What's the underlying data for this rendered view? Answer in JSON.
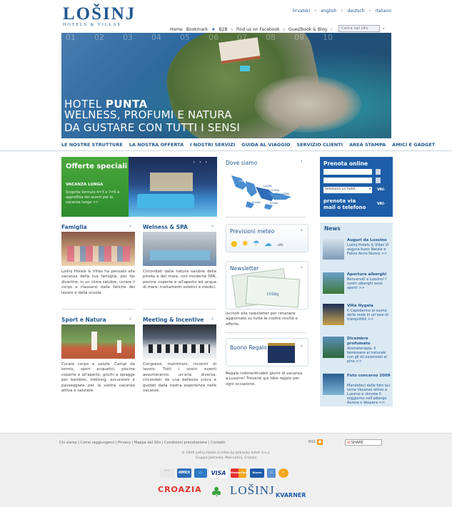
{
  "header": {
    "logo_word": "LOŠINJ",
    "logo_sub": "HOTELS & VILLAS",
    "languages": [
      "hrvatski",
      "english",
      "deutsch",
      "italiano"
    ],
    "topnav": [
      "Home",
      "Bookmark",
      "B2B",
      "Find us on Facebook",
      "Guestbook & Blog"
    ],
    "search_placeholder": "Cerca nel sito"
  },
  "hero": {
    "numbers": [
      "01",
      "02",
      "03",
      "04",
      "05",
      "06",
      "07",
      "08",
      "09",
      "10"
    ],
    "line1_a": "HOTEL",
    "line1_b": "PUNTA",
    "line2": "WELNESS, PROFUMI E NATURA",
    "line3": "DA GUSTARE CON TUTTI I SENSI"
  },
  "mainnav": [
    "LE NOSTRE STRUTTURE",
    "LA NOSTRA OFFERTA",
    "I NOSTRI SERVIZI",
    "GUIDA AL VIAGGIO",
    "SERVIZIO CLIENTI",
    "AREA STAMPA",
    "AMICI E GADGET"
  ],
  "offerte": {
    "title": "Offerte speciali",
    "subtitle": "VACANZA LUNGA",
    "desc": "Scoprite formule 4=3 o 7=5 e approfitta dei sconti per la vacanza lunga >>"
  },
  "sections": {
    "famiglia": {
      "title": "Famiglia",
      "text": "Lošinj Hotels & Villas ha pensato alla vacanza della tua famiglia, per far divertire, in un clima salubre, curare il corpo e rilassarsi dalle fatiche del lavoro e della scuola."
    },
    "welness": {
      "title": "Welness & SPA",
      "text": "Circondati dalla natura salubre della pineta e del mare, con moderne SPA, piscine coperte e all'aperto ad acqua di mare, trattamenti estetici e medici."
    },
    "sport": {
      "title": "Sport e Natura",
      "text": "Curare corpo e salute. Campi da tennis, sport acquatici, piscine coperte e all'aperto, giochi e spiagge per bambini, trekking, escursioni e passeggiate per la vostra vacanza attiva e salutare."
    },
    "meeting": {
      "title": "Meeting & Incentive",
      "text": "Congressi, matrimoni, incontri di lavoro. Tutti i vostri eventi assumeranno un'aria diversa, circondati da una bellezza unica e guidati dalla nostra esperienza nelle vacanze."
    }
  },
  "middle": {
    "dove_title": "Dove siamo",
    "map_labels": [
      "ČRES",
      "LOŠINJ",
      "MALI LOŠINJ",
      "VELI LOŠINJ",
      "SUSAK",
      "ILOVIK"
    ],
    "meteo_title": "Previsioni meteo",
    "newsletter_title": "Newsletter",
    "newsletter_text": "Iscriviti alla newsletter per rimanere aggiornato su tutte le nostre novità e offerte.",
    "buono_title": "Buono Regalo",
    "buono_text": "Regala indimenticabili giorni di vacanza a Lussino! Troverai qui idee regalo per ogni occasione."
  },
  "booking": {
    "title": "Prenota online",
    "select_placeholder": "Seleziona un hotel...",
    "go": "VAI›",
    "alt_title": "prenota via mail o telefono",
    "alt_go": "VAI›"
  },
  "news": {
    "title": "News",
    "items": [
      {
        "title": "Auguri da Lussino",
        "desc": "Lošinj Hotels & Villas Vi augura buon Natale e Felice Anno Nuovo >>"
      },
      {
        "title": "Aperture alberghi",
        "desc": "Benvenuti a Lussino! I nostri alberghi sono aperti >>"
      },
      {
        "title": "Villa Hygeia",
        "desc": "Il Capodanno al suono delle onde in un'oasi di tranquillità >>"
      },
      {
        "title": "Dicembre profumato",
        "desc": "Aromaterapia, il benessere al naturale con gli oli essenziali al pino >>"
      },
      {
        "title": "Foto concorso 2009",
        "desc": "Mandateci delle foto sul tema Vacanze attive a Lussino e vincete il soggiorno nell'albergo Aurora o Vespera >>"
      }
    ]
  },
  "footer": {
    "links": "Chi siamo | Come raggiungerci | Privacy | Mappa del Sito | Condizioni prenotazione | Contatti",
    "copy1": "© 2009 Lošinj Hotels & Villas by Jadranka hoteli d.o.o.",
    "copy2": "Gruppo Jadranka, Mali Lošinj, Croazia",
    "rss": "RSS",
    "share": "SHARE",
    "payments": [
      "AMEX",
      "VISA",
      "MasterCard",
      "Diners"
    ],
    "brands": [
      "CROAZIA",
      "LOŠINJ",
      "KVARNER"
    ]
  }
}
